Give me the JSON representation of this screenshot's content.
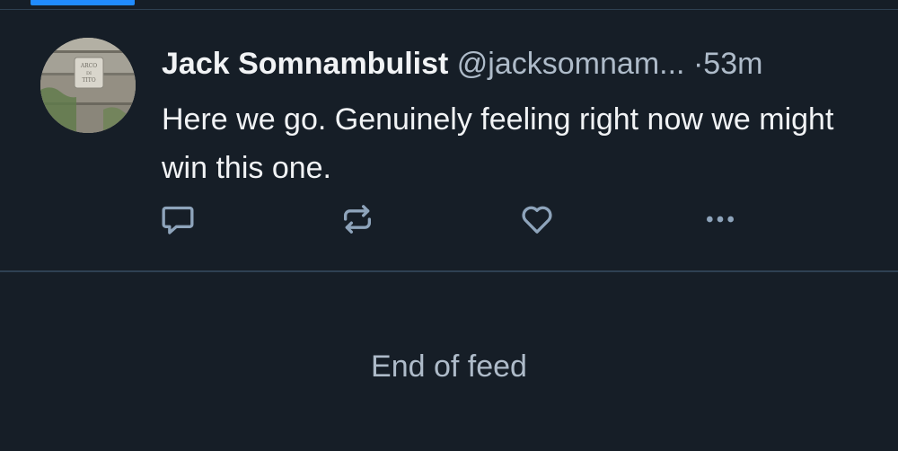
{
  "colors": {
    "background": "#161e27",
    "accent": "#208bfe",
    "divider": "#2e4052",
    "primary_text": "#f1f3f5",
    "secondary_text": "#aebbc9",
    "icon": "#8ea4bb"
  },
  "feed": {
    "post": {
      "display_name": "Jack Somnambulist",
      "handle": "@jacksomnam...",
      "separator": "·",
      "timestamp": "53m",
      "text": "Here we go. Genuinely feeling right now we might win this one.",
      "avatar_plaque_text": "ARCO DI TITO",
      "actions": [
        {
          "name": "reply",
          "icon": "speech-bubble-icon"
        },
        {
          "name": "repost",
          "icon": "repost-arrows-icon"
        },
        {
          "name": "like",
          "icon": "heart-icon"
        },
        {
          "name": "more",
          "icon": "ellipsis-icon"
        }
      ]
    },
    "end_label": "End of feed"
  }
}
